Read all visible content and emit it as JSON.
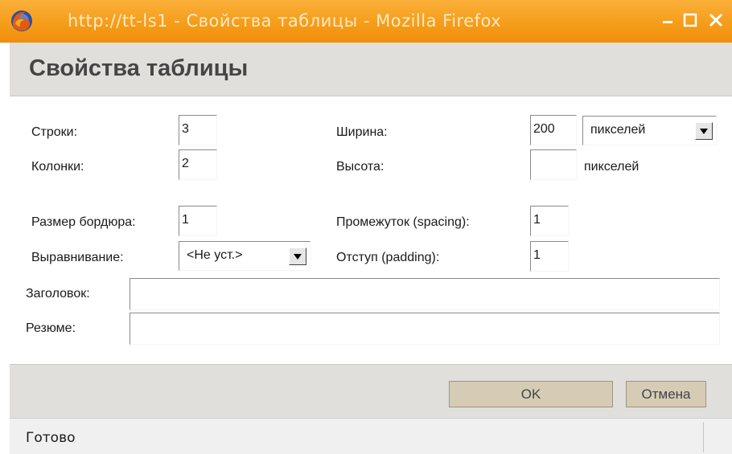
{
  "window": {
    "title": "http://tt-ls1 - Свойства таблицы - Mozilla Firefox"
  },
  "dialog": {
    "title": "Свойства таблицы"
  },
  "form": {
    "rows_label": "Строки:",
    "rows_value": "3",
    "cols_label": "Колонки:",
    "cols_value": "2",
    "width_label": "Ширина:",
    "width_value": "200",
    "width_unit_selected": "пикселей",
    "height_label": "Высота:",
    "height_value": "",
    "height_unit_text": "пикселей",
    "border_label": "Размер бордюра:",
    "border_value": "1",
    "align_label": "Выравнивание:",
    "align_selected": "<Не уст.>",
    "spacing_label": "Промежуток (spacing):",
    "spacing_value": "1",
    "padding_label": "Отступ (padding):",
    "padding_value": "1",
    "caption_label": "Заголовок:",
    "caption_value": "",
    "summary_label": "Резюме:",
    "summary_value": ""
  },
  "buttons": {
    "ok_label": "OK",
    "cancel_label": "Отмена"
  },
  "status": {
    "text": "Готово"
  },
  "colors": {
    "titlebar": "#f59d1a",
    "panel": "#e0dfdb",
    "button": "#d6ccb6"
  },
  "icons": [
    "firefox-icon",
    "minimize-icon",
    "maximize-icon",
    "close-icon",
    "dropdown-arrow-icon"
  ]
}
